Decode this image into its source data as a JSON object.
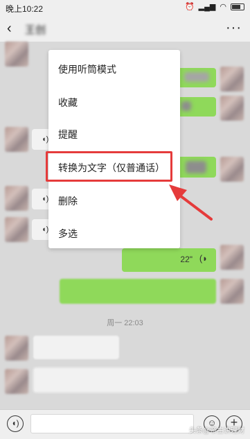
{
  "status_bar": {
    "time": "晚上10:22",
    "icons": [
      "alarm-icon",
      "signal-icon",
      "wifi-icon",
      "battery-icon"
    ]
  },
  "header": {
    "title": "王创"
  },
  "context_menu": {
    "items": [
      "使用听筒模式",
      "收藏",
      "提醒",
      "转换为文字（仅普通话）",
      "删除",
      "多选"
    ],
    "highlighted_index": 3
  },
  "messages": {
    "voice_duration": "22\"",
    "date_separator": "周一 22:03"
  },
  "colors": {
    "accent_green": "#8fd95a",
    "highlight_red": "#e53b3b",
    "background": "#d9d9d9"
  },
  "watermark": "头条@帝主讲理财"
}
